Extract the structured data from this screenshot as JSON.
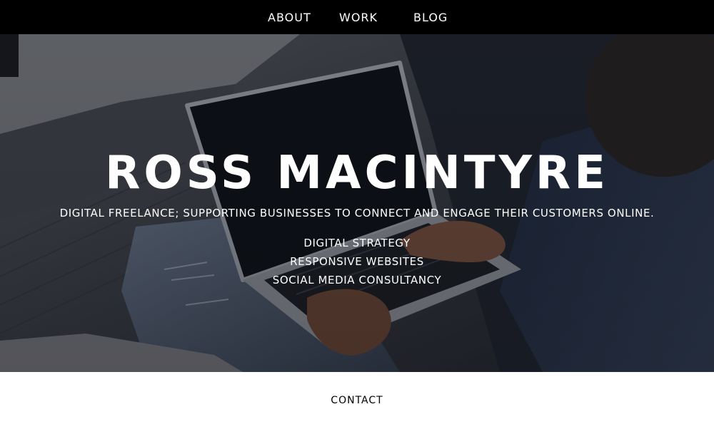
{
  "nav": {
    "items": [
      {
        "label": "ABOUT"
      },
      {
        "label": "WORK"
      },
      {
        "label": "BLOG"
      }
    ]
  },
  "hero": {
    "title": "ROSS MACINTYRE",
    "tagline": "DIGITAL FREELANCE; SUPPORTING BUSINESSES TO CONNECT AND ENGAGE THEIR CUSTOMERS ONLINE.",
    "services": [
      "DIGITAL STRATEGY",
      "RESPONSIVE WEBSITES",
      "SOCIAL MEDIA CONSULTANCY"
    ]
  },
  "footer": {
    "contact_label": "CONTACT"
  },
  "colors": {
    "nav_background": "#000000",
    "text_on_dark": "#ffffff",
    "page_background": "#ffffff",
    "contact_text": "#000000"
  }
}
